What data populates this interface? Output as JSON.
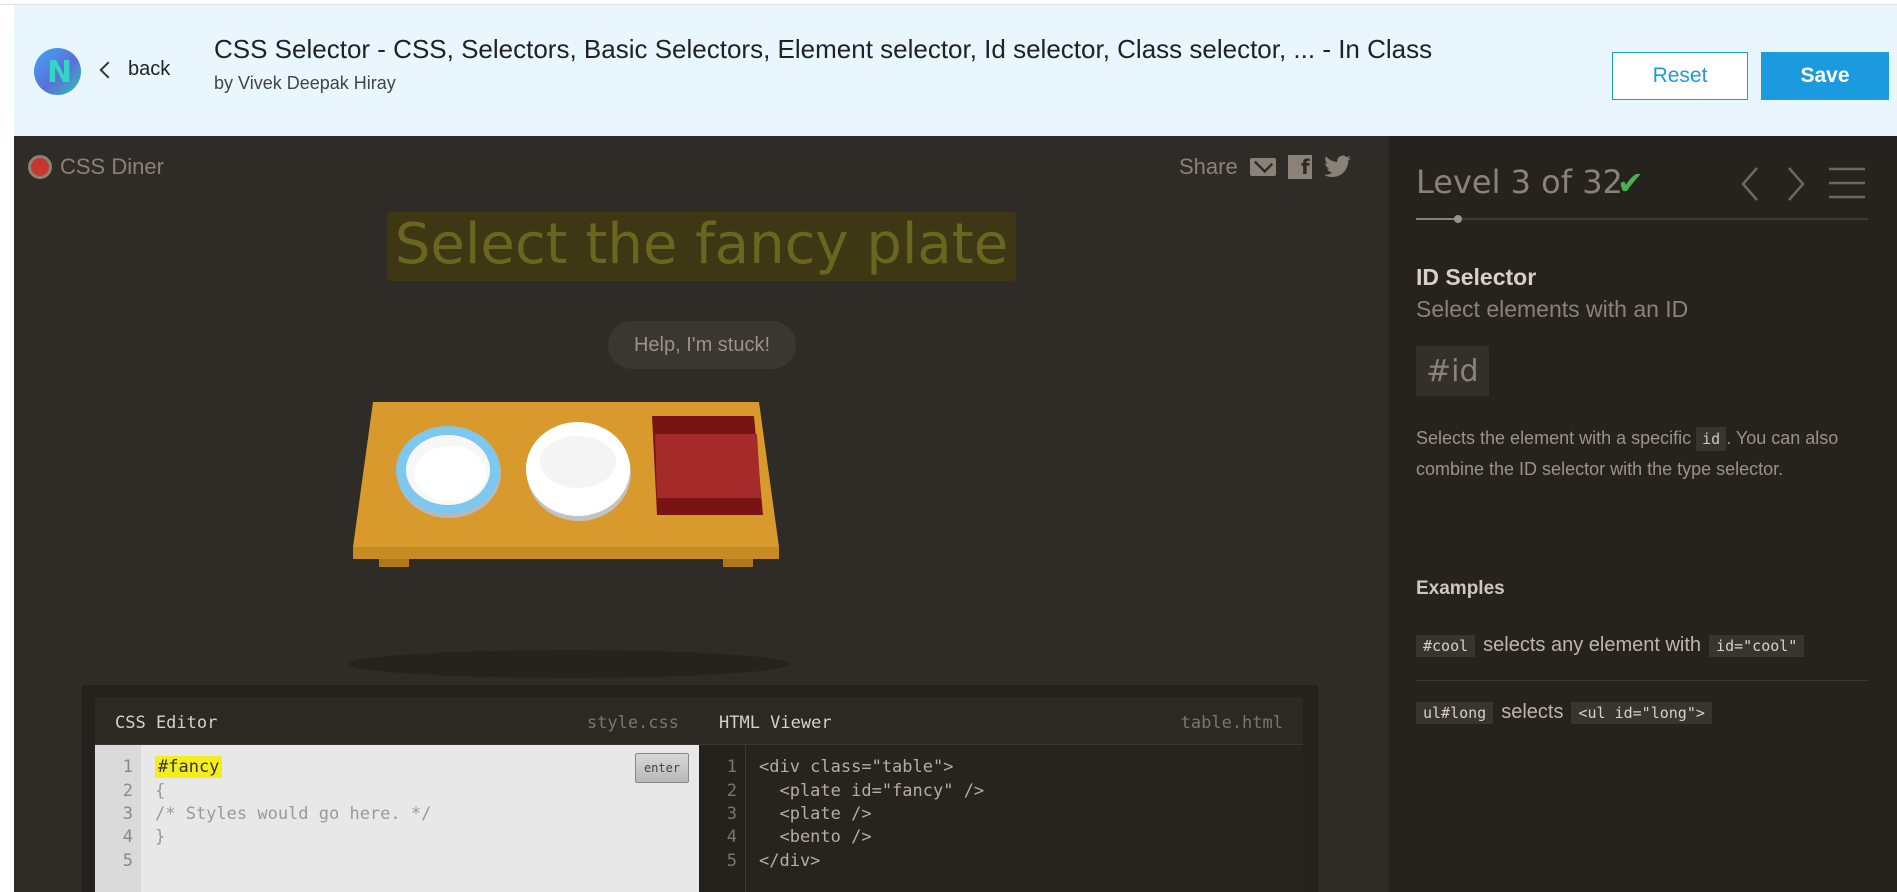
{
  "header": {
    "logo_letter": "N",
    "back_label": "back",
    "title": "CSS Selector - CSS, Selectors, Basic Selectors, Element selector, Id selector, Class selector, ... - In Class",
    "author": "by Vivek Deepak Hiray",
    "reset_label": "Reset",
    "save_label": "Save"
  },
  "game": {
    "brand": "CSS Diner",
    "share_label": "Share",
    "order": "Select the fancy plate",
    "help_label": "Help, I'm stuck!",
    "table_items": [
      "plate#fancy",
      "plate",
      "bento"
    ]
  },
  "css_editor": {
    "title": "CSS Editor",
    "file": "style.css",
    "line_numbers": [
      "1",
      "2",
      "3",
      "4",
      "5"
    ],
    "input_value": "#fancy",
    "lines": [
      "{",
      "/* Styles would go here. */",
      "}"
    ],
    "enter_label": "enter"
  },
  "html_viewer": {
    "title": "HTML Viewer",
    "file": "table.html",
    "line_numbers": [
      "1",
      "2",
      "3",
      "4",
      "5"
    ],
    "lines": [
      "<div class=\"table\">",
      "  <plate id=\"fancy\" />",
      "  <plate />",
      "  <bento />",
      "</div>"
    ]
  },
  "sidebar": {
    "level_text": "Level 3 of 32",
    "level_complete": true,
    "level_current": 3,
    "level_total": 32,
    "selector_name": "ID Selector",
    "selector_title": "Select elements with an ID",
    "syntax": "#id",
    "hint_before": "Selects the element with a specific ",
    "hint_code": "id",
    "hint_after": ". You can also combine the ID selector with the type selector.",
    "examples_heading": "Examples",
    "examples": [
      {
        "code": "#cool",
        "text": "selects any element with",
        "code2": "id=\"cool\""
      },
      {
        "code": "ul#long",
        "text": "selects",
        "code2": "<ul id=\"long\">"
      }
    ]
  },
  "colors": {
    "accent": "#1b9ae0",
    "header_bg": "#eaf6fd",
    "game_bg": "#2f2b26",
    "sidebar_bg": "#26231f",
    "check": "#4caf50",
    "input_highlight": "#f3ee1c"
  },
  "icons": [
    "logo-icon",
    "chevron-left-icon",
    "diner-logo-icon",
    "mail-icon",
    "facebook-icon",
    "twitter-icon",
    "checkmark-icon",
    "arrow-left-icon",
    "arrow-right-icon",
    "menu-icon"
  ]
}
